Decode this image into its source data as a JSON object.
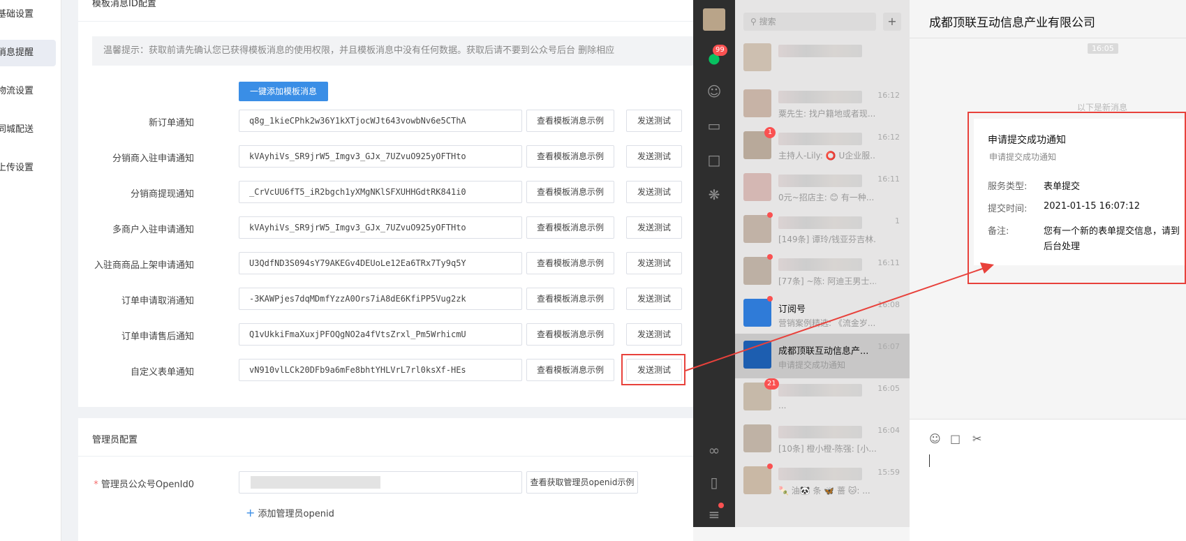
{
  "sidebar": {
    "items": [
      {
        "label": "基础设置",
        "active": false
      },
      {
        "label": "消息提醒",
        "active": true
      },
      {
        "label": "物流设置",
        "active": false
      },
      {
        "label": "同城配送",
        "active": false
      },
      {
        "label": "上传设置",
        "active": false
      }
    ]
  },
  "template_section": {
    "title": "模板消息ID配置",
    "tip": "温馨提示：获取前请先确认您已获得模板消息的使用权限，并且模板消息中没有任何数据。获取后请不要到公众号后台 删除相应",
    "add_button": "一键添加模板消息",
    "example_label": "查看模板消息示例",
    "send_label": "发送测试",
    "rows": [
      {
        "label": "新订单通知",
        "value": "q8g_1kieCPhk2w36Y1kXTjocWJt643vowbNv6e5CThA"
      },
      {
        "label": "分销商入驻申请通知",
        "value": "kVAyhiVs_SR9jrW5_Imgv3_GJx_7UZvuO925yOFTHto"
      },
      {
        "label": "分销商提现通知",
        "value": "_CrVcUU6fT5_iR2bgch1yXMgNKlSFXUHHGdtRK841i0"
      },
      {
        "label": "多商户入驻申请通知",
        "value": "kVAyhiVs_SR9jrW5_Imgv3_GJx_7UZvuO925yOFTHto"
      },
      {
        "label": "入驻商商品上架申请通知",
        "value": "U3QdfND3S094sY79AKEGv4DEUoLe12Ea6TRx7Ty9q5Y"
      },
      {
        "label": "订单申请取消通知",
        "value": "-3KAWPjes7dqMDmfYzzA0Ors7iA8dE6KfiPP5Vug2zk"
      },
      {
        "label": "订单申请售后通知",
        "value": "Q1vUkkiFmaXuxjPFOQgNO2a4fVtsZrxl_Pm5WrhicmU"
      },
      {
        "label": "自定义表单通知",
        "value": "vN910vlLCk20DFb9a6mFe8bhtYHLVrL7rl0ksXf-HEs"
      }
    ]
  },
  "admin_section": {
    "title": "管理员配置",
    "openid_label": "管理员公众号OpenId0",
    "required_mark": "*",
    "openid_example": "查看获取管理员openid示例",
    "add_openid": "添加管理员openid",
    "add_icon": "plus-icon"
  },
  "wechat": {
    "unread_badge": "99",
    "search_placeholder": "搜索",
    "add_symbol": "+",
    "chat_title": "成都顶联互动信息产业有限公司",
    "time_stamp": "16:05",
    "new_msg_divider": "以下是新消息",
    "conversations": [
      {
        "name": "",
        "preview": "",
        "time": "",
        "selected": false,
        "avatar_color": "#cdbfb0"
      },
      {
        "name": "",
        "preview": "粟先生: 找户籍地或者现...",
        "time": "16:12",
        "selected": false,
        "avatar_color": "#c7b3a6"
      },
      {
        "name": "",
        "preview": "主持人-Lily: ⭕ U企业服...",
        "time": "16:12",
        "selected": false,
        "avatar_color": "#b8a99a",
        "badge": "1"
      },
      {
        "name": "",
        "preview": "0元~招店主: 😊 有一种...",
        "time": "16:11",
        "selected": false,
        "avatar_color": "#d4b7b3"
      },
      {
        "name": "",
        "preview": "[149条] 谭玲/钱亚芬吉林...",
        "time": "1",
        "selected": false,
        "avatar_color": "#c1b2a6",
        "dot": true
      },
      {
        "name": "",
        "preview": "[77条] ~陈: 阿迪王男士...",
        "time": "16:11",
        "selected": false,
        "avatar_color": "#bdb0a4",
        "dot": true
      },
      {
        "name": "订阅号",
        "preview": "营销案例精选: 《流金岁...",
        "time": "16:08",
        "selected": false,
        "avatar_color": "#2f7bd8",
        "dot": true
      },
      {
        "name": "成都顶联互动信息产...",
        "preview": "申请提交成功通知",
        "time": "16:07",
        "selected": true,
        "avatar_color": "#1d5eb0"
      },
      {
        "name": "",
        "preview": "...",
        "time": "16:05",
        "selected": false,
        "avatar_color": "#c6b9a9",
        "badge": "21"
      },
      {
        "name": "",
        "preview": "[10条] 橙小橙-陈强: [小...",
        "time": "16:04",
        "selected": false,
        "avatar_color": "#bfb2a5"
      },
      {
        "name": "",
        "preview": "🍡 油🐼 条 🦋 蔷 🐱: ...",
        "time": "15:59",
        "selected": false,
        "avatar_color": "#c9b8a5",
        "dot": true
      }
    ],
    "message": {
      "title": "申请提交成功通知",
      "subtitle": "申请提交成功通知",
      "fields": [
        {
          "label": "服务类型:",
          "value": "表单提交"
        },
        {
          "label": "提交时间:",
          "value": "2021-01-15 16:07:12"
        },
        {
          "label": "备注:",
          "value": "您有一个新的表单提交信息，请到"
        }
      ],
      "remark_cont": "后台处理"
    },
    "rail_icons": [
      "chat-icon",
      "contacts-icon",
      "box-icon",
      "folder-icon",
      "settings-icon",
      "link-icon",
      "phone-icon",
      "menu-icon"
    ],
    "input_tools": [
      "emoji-icon",
      "folder-icon",
      "scissors-icon"
    ]
  },
  "colors": {
    "primary": "#3a8ee6",
    "annotation_red": "#e8413b",
    "wechat_rail": "#2e2e2e",
    "wechat_list": "#e6e5e5",
    "badge": "#fa5151"
  }
}
